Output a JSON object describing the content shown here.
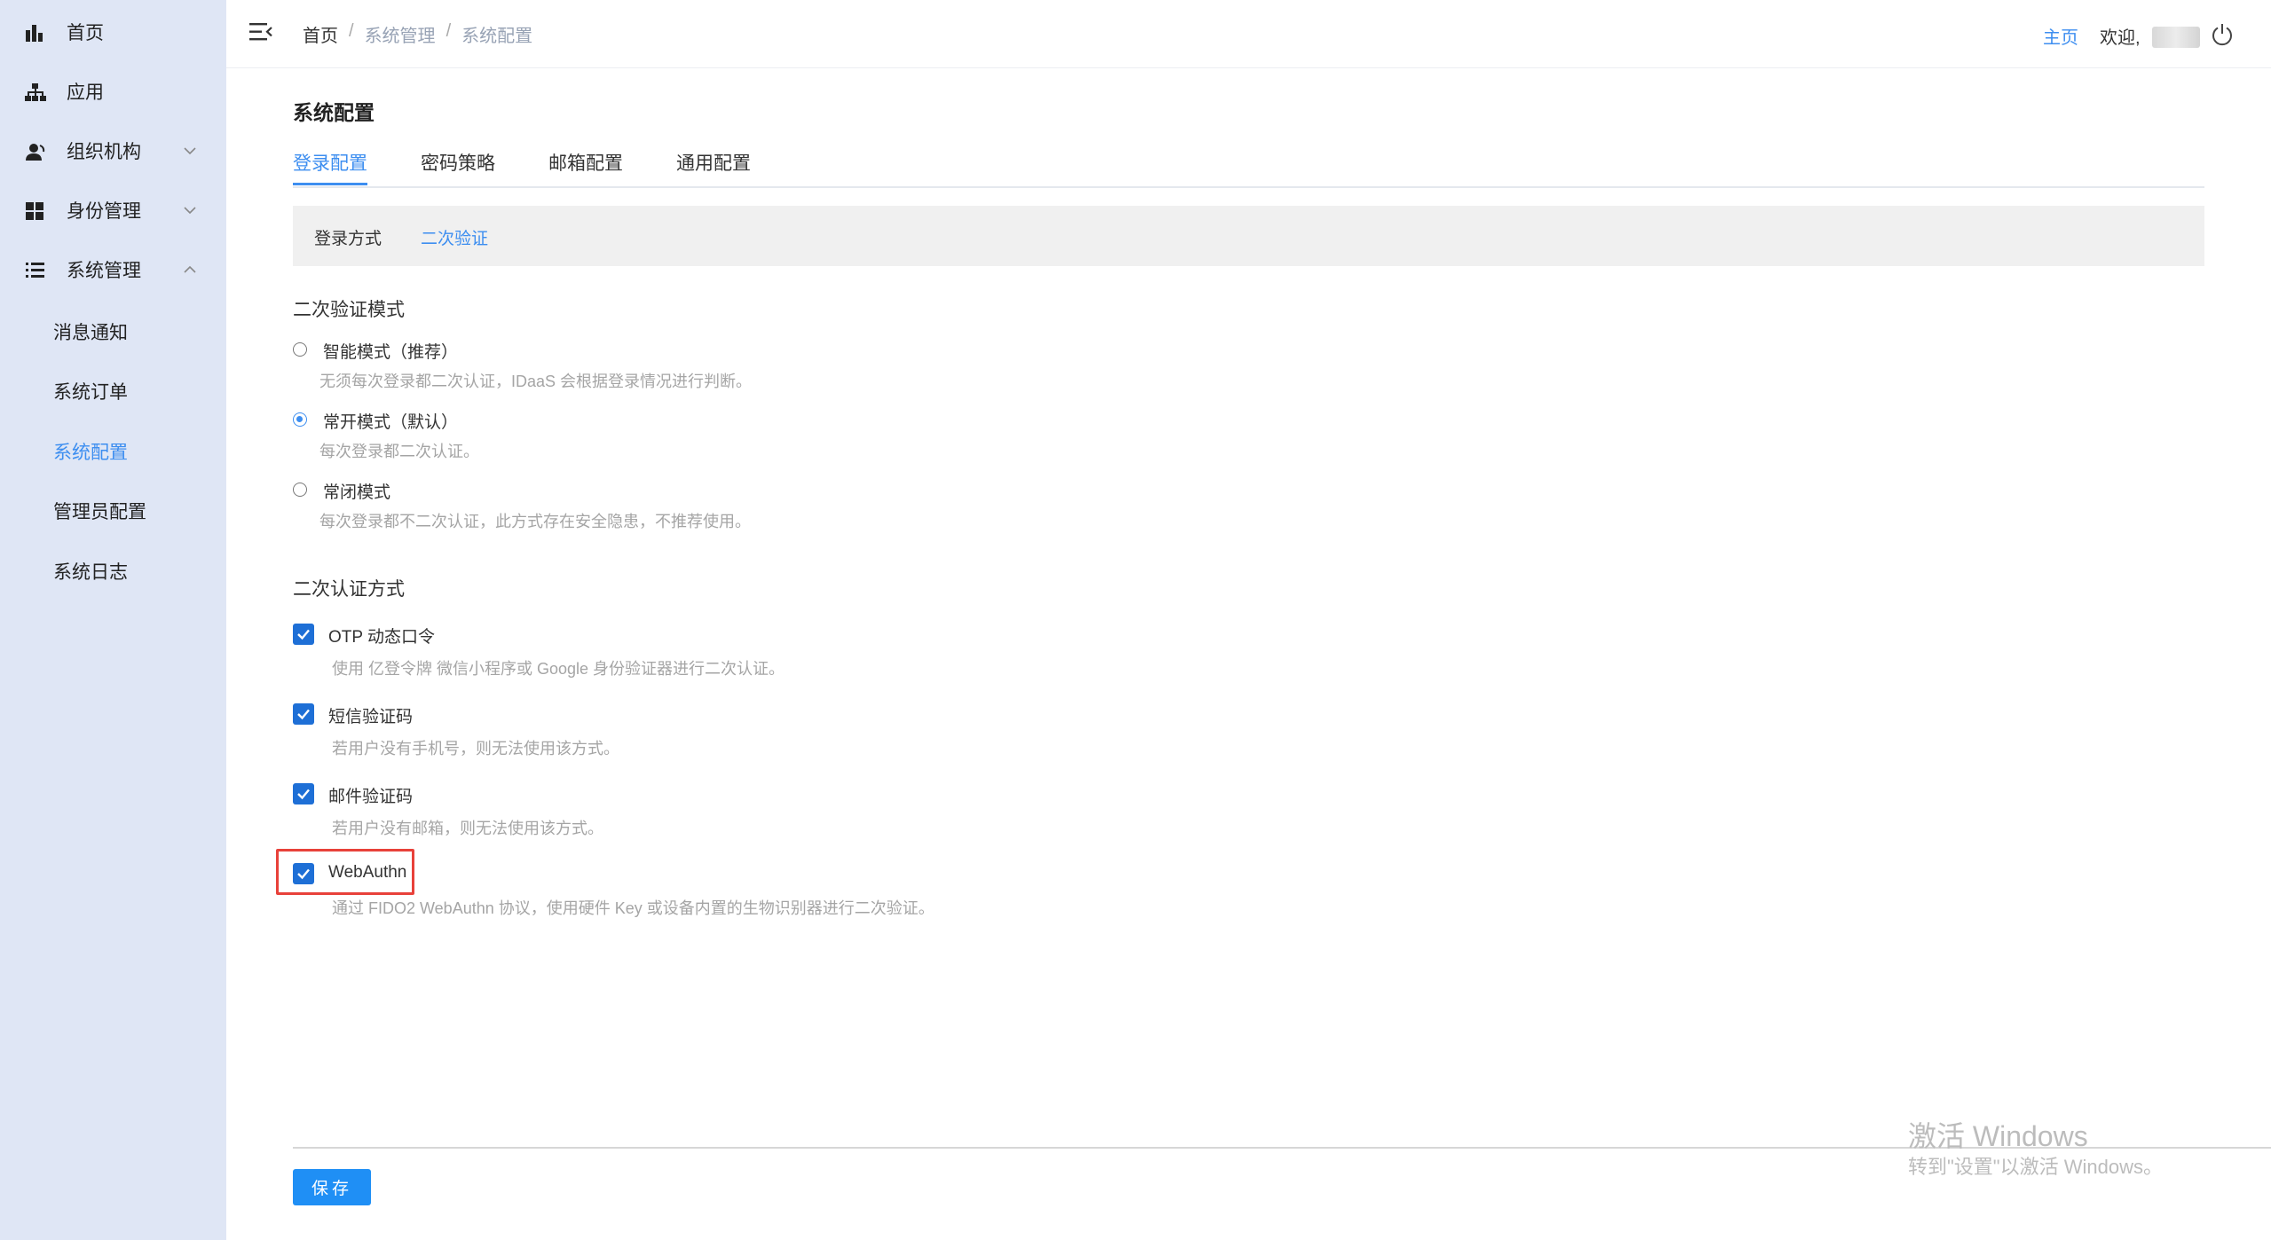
{
  "sidebar": {
    "items": [
      {
        "label": "首页",
        "icon": "bar-chart-icon"
      },
      {
        "label": "应用",
        "icon": "sitemap-icon"
      },
      {
        "label": "组织机构",
        "icon": "user-icon"
      },
      {
        "label": "身份管理",
        "icon": "grid-icon"
      },
      {
        "label": "系统管理",
        "icon": "list-icon"
      }
    ],
    "sub_items": [
      {
        "label": "消息通知"
      },
      {
        "label": "系统订单"
      },
      {
        "label": "系统配置"
      },
      {
        "label": "管理员配置"
      },
      {
        "label": "系统日志"
      }
    ]
  },
  "header": {
    "breadcrumb": [
      "首页",
      "系统管理",
      "系统配置"
    ],
    "separator": "/",
    "home_link": "主页",
    "welcome": "欢迎,"
  },
  "main": {
    "title": "系统配置",
    "tabs": [
      "登录配置",
      "密码策略",
      "邮箱配置",
      "通用配置"
    ],
    "subtabs": [
      "登录方式",
      "二次验证"
    ],
    "verify_mode": {
      "title": "二次验证模式",
      "options": [
        {
          "label": "智能模式（推荐）",
          "desc": "无须每次登录都二次认证，IDaaS 会根据登录情况进行判断。",
          "checked": false
        },
        {
          "label": "常开模式（默认）",
          "desc": "每次登录都二次认证。",
          "checked": true
        },
        {
          "label": "常闭模式",
          "desc": "每次登录都不二次认证，此方式存在安全隐患，不推荐使用。",
          "checked": false
        }
      ]
    },
    "verify_methods": {
      "title": "二次认证方式",
      "options": [
        {
          "label": "OTP 动态口令",
          "desc": "使用 亿登令牌 微信小程序或 Google 身份验证器进行二次认证。",
          "checked": true
        },
        {
          "label": "短信验证码",
          "desc": "若用户没有手机号，则无法使用该方式。",
          "checked": true
        },
        {
          "label": "邮件验证码",
          "desc": "若用户没有邮箱，则无法使用该方式。",
          "checked": true
        },
        {
          "label": "WebAuthn",
          "desc": "通过 FIDO2 WebAuthn 协议，使用硬件 Key 或设备内置的生物识别器进行二次验证。",
          "checked": true
        }
      ]
    },
    "save_label": "保存"
  },
  "watermark": {
    "line1": "激活 Windows",
    "line2": "转到\"设置\"以激活 Windows。"
  },
  "colors": {
    "accent": "#3d8ef0",
    "sidebar_bg": "#dfe6f5",
    "checkbox": "#1e6fd6",
    "highlight": "#e8413a"
  }
}
